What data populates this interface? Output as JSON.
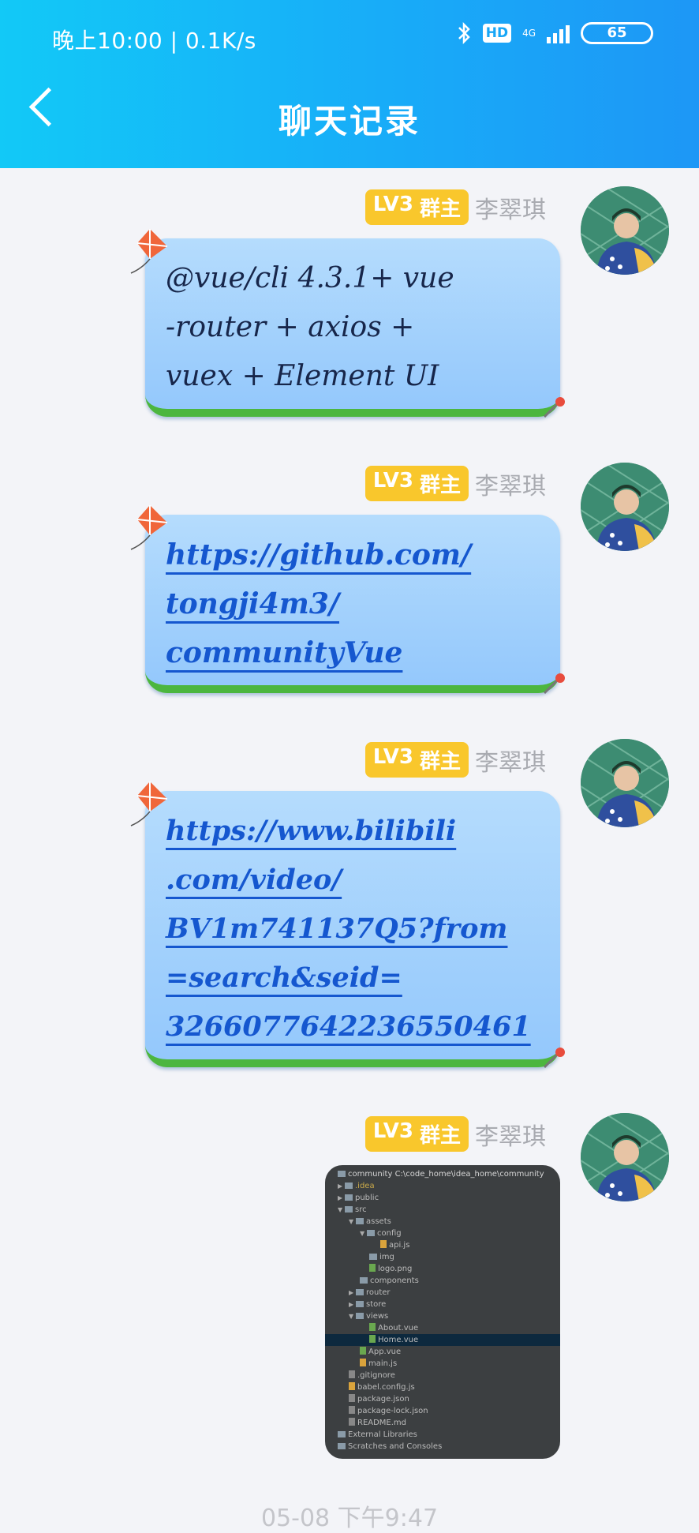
{
  "status_bar": {
    "time_speed": "晚上10:00 | 0.1K/s",
    "hd": "HD",
    "network": "4G",
    "battery": "65"
  },
  "header": {
    "title": "聊天记录"
  },
  "messages": [
    {
      "level": "LV3",
      "role": "群主",
      "sender": "李翠琪",
      "lines": [
        "@vue/cli 4.3.1+ vue",
        "-router + axios +",
        "vuex + Element UI"
      ]
    },
    {
      "level": "LV3",
      "role": "群主",
      "sender": "李翠琪",
      "lines": [
        "https://github.com/",
        "tongji4m3/",
        "communityVue"
      ]
    },
    {
      "level": "LV3",
      "role": "群主",
      "sender": "李翠琪",
      "lines": [
        "https://www.bilibili",
        ".com/video/",
        "BV1m741137Q5?from",
        "=search&seid=",
        "3266077642236550461"
      ]
    },
    {
      "level": "LV3",
      "role": "群主",
      "sender": "李翠琪",
      "image_tree": [
        "community  C:\\code_home\\idea_home\\community",
        ".idea",
        "public",
        "src",
        "assets",
        "config",
        "api.js",
        "img",
        "logo.png",
        "components",
        "router",
        "store",
        "views",
        "About.vue",
        "Home.vue",
        "App.vue",
        "main.js",
        ".gitignore",
        "babel.config.js",
        "package.json",
        "package-lock.json",
        "README.md",
        "External Libraries",
        "Scratches and Consoles"
      ]
    }
  ],
  "footer_time": "05-08 下午9:47",
  "colors": {
    "header_start": "#12c9f7",
    "header_end": "#1d97f6",
    "badge": "#f9c72c",
    "link": "#1557cf"
  }
}
